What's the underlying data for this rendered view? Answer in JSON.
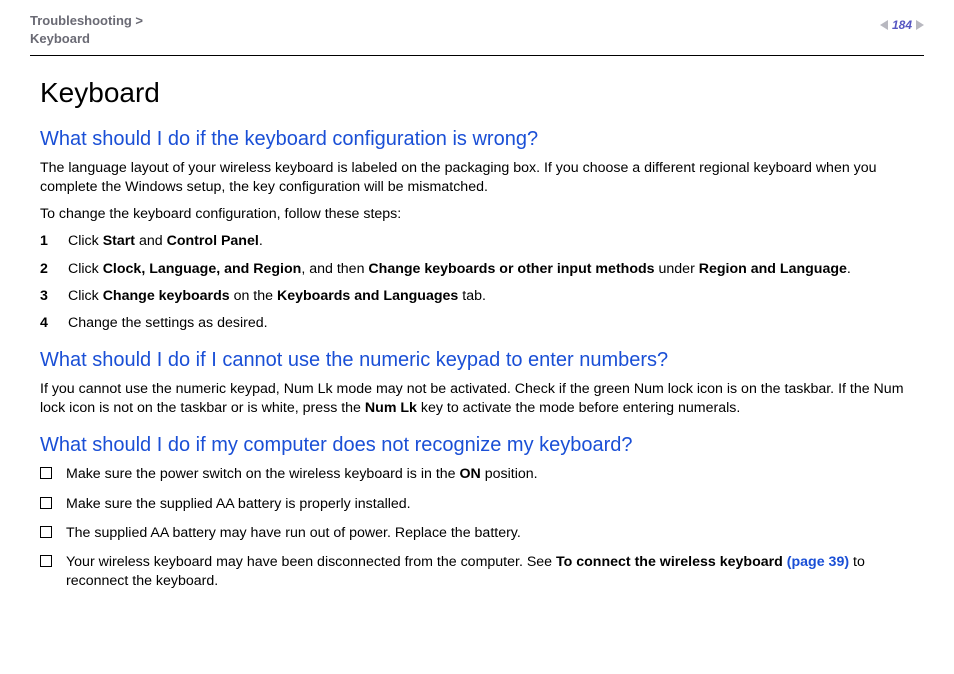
{
  "breadcrumb": {
    "line1": "Troubleshooting >",
    "line2": "Keyboard"
  },
  "pageNumber": "184",
  "title": "Keyboard",
  "q1": {
    "heading": "What should I do if the keyboard configuration is wrong?",
    "p1": "The language layout of your wireless keyboard is labeled on the packaging box. If you choose a different regional keyboard when you complete the Windows setup, the key configuration will be mismatched.",
    "p2": "To change the keyboard configuration, follow these steps:",
    "steps": {
      "s1": {
        "num": "1",
        "a": "Click ",
        "b1": "Start",
        "b": " and ",
        "b2": "Control Panel",
        "c": "."
      },
      "s2": {
        "num": "2",
        "a": "Click ",
        "b1": "Clock, Language, and Region",
        "b": ", and then ",
        "b2": "Change keyboards or other input methods",
        "c": " under ",
        "b3": "Region and Language",
        "d": "."
      },
      "s3": {
        "num": "3",
        "a": "Click ",
        "b1": "Change keyboards",
        "b": " on the ",
        "b2": "Keyboards and Languages",
        "c": " tab."
      },
      "s4": {
        "num": "4",
        "a": "Change the settings as desired."
      }
    }
  },
  "q2": {
    "heading": "What should I do if I cannot use the numeric keypad to enter numbers?",
    "p1a": "If you cannot use the numeric keypad, Num Lk mode may not be activated. Check if the green Num lock icon is on the taskbar. If the Num lock icon is not on the taskbar or is white, press the ",
    "p1b": "Num Lk",
    "p1c": " key to activate the mode before entering numerals."
  },
  "q3": {
    "heading": "What should I do if my computer does not recognize my keyboard?",
    "items": {
      "i1": {
        "a": "Make sure the power switch on the wireless keyboard is in the ",
        "b": "ON",
        "c": " position."
      },
      "i2": {
        "a": "Make sure the supplied AA battery is properly installed."
      },
      "i3": {
        "a": "The supplied AA battery may have run out of power. Replace the battery."
      },
      "i4": {
        "a": "Your wireless keyboard may have been disconnected from the computer. See ",
        "b": "To connect the wireless keyboard",
        "link": " (page 39)",
        "c": " to reconnect the keyboard."
      }
    }
  }
}
